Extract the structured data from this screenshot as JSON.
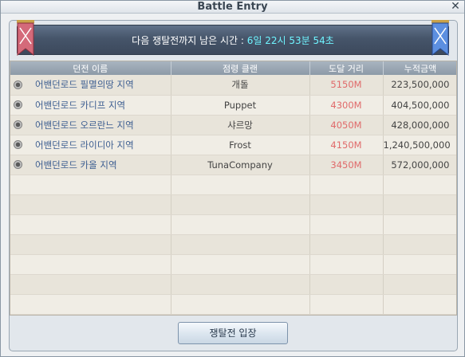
{
  "window": {
    "title": "Battle Entry",
    "close_label": "✕"
  },
  "banner": {
    "label": "다음 쟁탈전까지 남은 시간 :",
    "time": "6일 22시 53분 54초"
  },
  "table": {
    "headers": [
      "던전 이름",
      "점령 클랜",
      "도달 거리",
      "누적금액"
    ],
    "rows": [
      {
        "name": "어밴던로드 필멸의땅 지역",
        "clan": "개돌",
        "distance": "5150M",
        "amount": "223,500,000"
      },
      {
        "name": "어밴던로드 카디프 지역",
        "clan": "Puppet",
        "distance": "4300M",
        "amount": "404,500,000"
      },
      {
        "name": "어밴던로드 오르란느 지역",
        "clan": "샤르망",
        "distance": "4050M",
        "amount": "428,000,000"
      },
      {
        "name": "어밴던로드 라이디아 지역",
        "clan": "Frost",
        "distance": "4150M",
        "amount": "1,240,500,000"
      },
      {
        "name": "어밴던로드 카올 지역",
        "clan": "TunaCompany",
        "distance": "3450M",
        "amount": "572,000,000"
      }
    ],
    "empty_rows": 7
  },
  "actions": {
    "enter_label": "쟁탈전 입장"
  },
  "colors": {
    "banner_bg": "#46556a",
    "time_text": "#6ff4ff",
    "distance_text": "#e06a6a",
    "name_text": "#3d5e91"
  }
}
